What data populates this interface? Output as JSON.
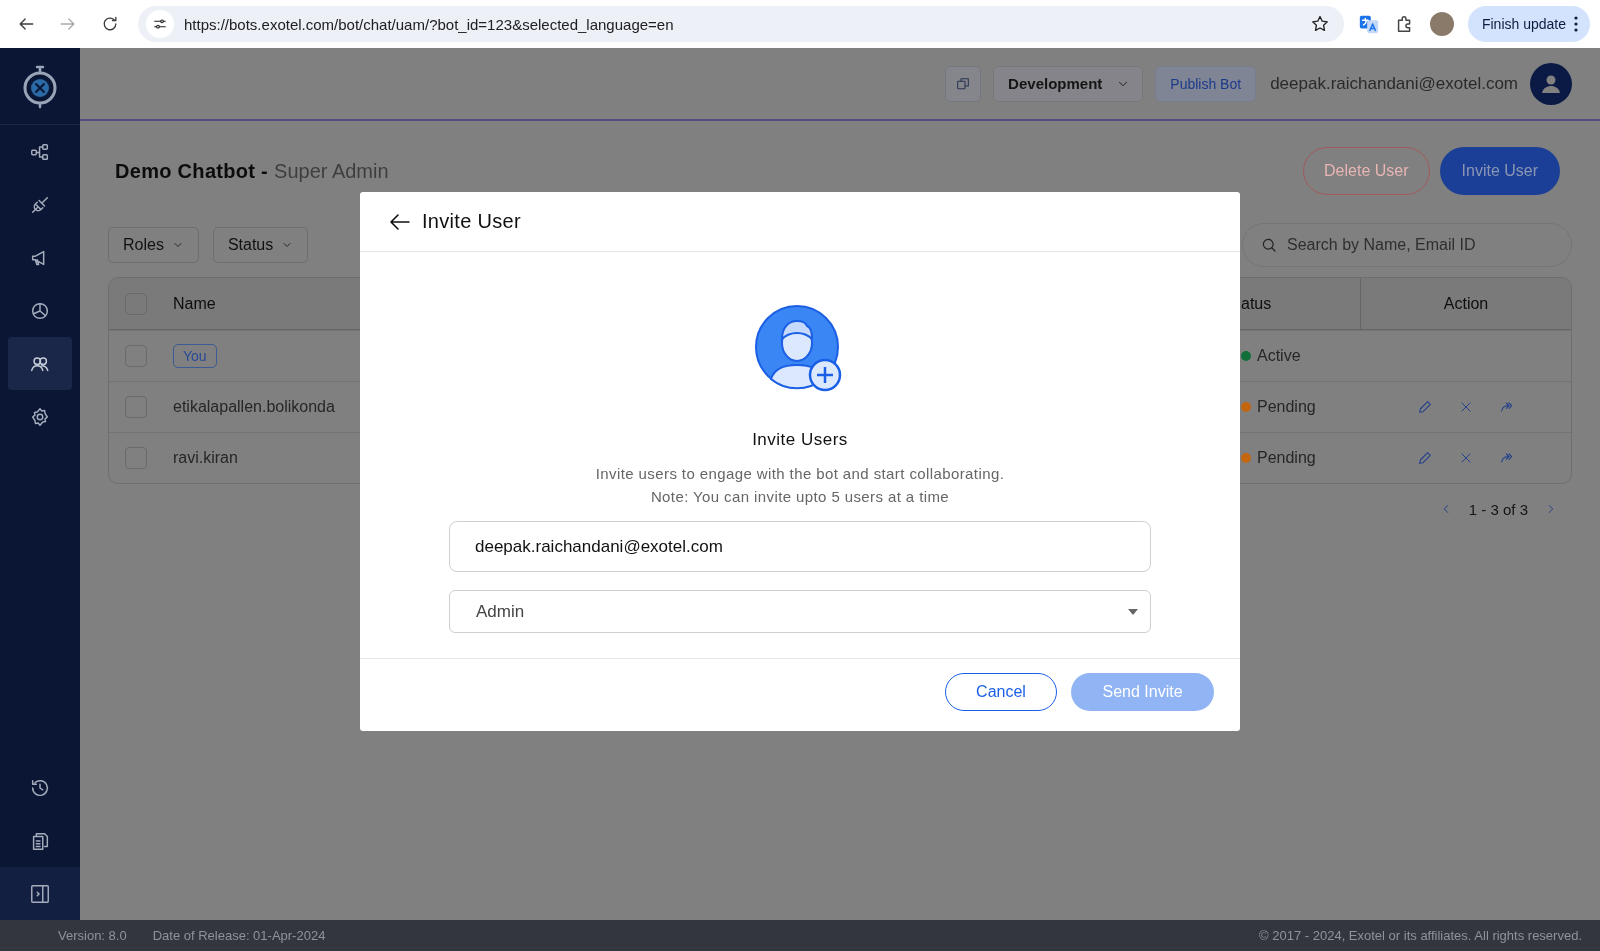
{
  "browser": {
    "url": "https://bots.exotel.com/bot/chat/uam/?bot_id=123&selected_language=en",
    "update_button": "Finish update"
  },
  "topbar": {
    "environment": "Development",
    "publish_button": "Publish Bot",
    "user_email": "deepak.raichandani@exotel.com"
  },
  "sidebar": {
    "items": [
      {
        "selected": false
      },
      {
        "selected": false
      },
      {
        "selected": false
      },
      {
        "selected": false
      },
      {
        "selected": true
      },
      {
        "selected": false
      }
    ]
  },
  "page": {
    "title": "Demo Chatbot -",
    "role": "Super Admin",
    "delete_button": "Delete User",
    "invite_button": "Invite User"
  },
  "filters": [
    "Roles",
    "Status"
  ],
  "search": {
    "placeholder": "Search by Name, Email ID"
  },
  "table": {
    "header_checked": false,
    "columns": [
      "Name",
      "atus",
      "Action"
    ],
    "rows": [
      {
        "checked": false,
        "name": "You",
        "kind": "tag",
        "status": "Active",
        "color": "#11703a",
        "has_actions": false
      },
      {
        "checked": false,
        "name": "etikalapallen.bolikonda",
        "kind": "text",
        "status": "Pending",
        "color": "#c4650f",
        "has_actions": true
      },
      {
        "checked": false,
        "name": "ravi.kiran",
        "kind": "text",
        "status": "Pending",
        "color": "#c4650f",
        "has_actions": true
      }
    ]
  },
  "pagination": "1 - 3 of 3",
  "modal": {
    "title": "Invite User",
    "heading": "Invite Users",
    "description": "Invite users to engage with the bot and start collaborating.",
    "note": "Note: You can invite upto 5 users at a time",
    "email": "deepak.raichandani@exotel.com",
    "role": "Admin",
    "cancel_button": "Cancel",
    "send_button": "Send Invite",
    "send_disabled": true
  },
  "footer": {
    "version": "Version: 8.0",
    "release": "Date of Release: 01-Apr-2024",
    "copyright": "© 2017 - 2024, Exotel or its affiliates. All rights reserved."
  }
}
